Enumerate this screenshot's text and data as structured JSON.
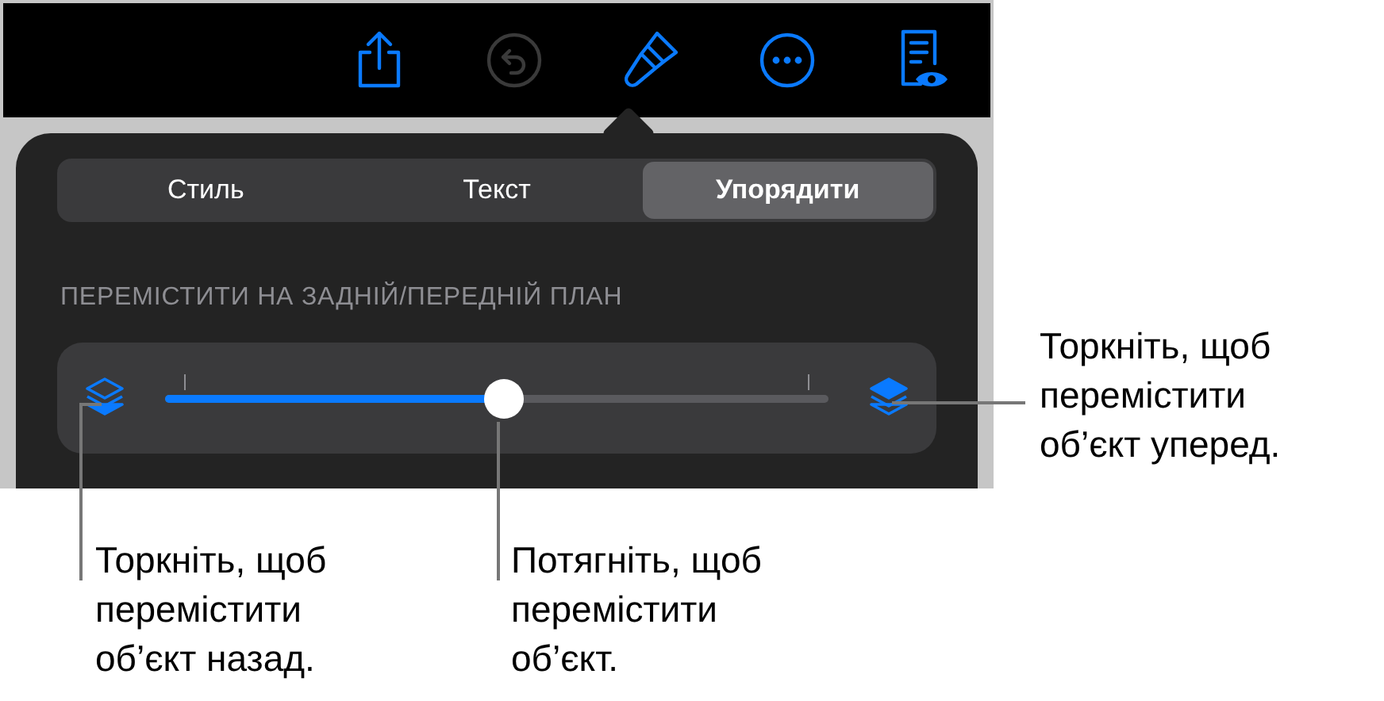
{
  "toolbar": {
    "buttons": [
      {
        "kind": "share",
        "disabled": false
      },
      {
        "kind": "undo",
        "disabled": true
      },
      {
        "kind": "format",
        "disabled": false
      },
      {
        "kind": "more",
        "disabled": false
      },
      {
        "kind": "reader",
        "disabled": false
      }
    ]
  },
  "segments": [
    {
      "label": "Стиль",
      "selected": false
    },
    {
      "label": "Текст",
      "selected": false
    },
    {
      "label": "Упорядити",
      "selected": true
    }
  ],
  "section_title": "ПЕРЕМІСТИТИ НА ЗАДНІЙ/ПЕРЕДНІЙ ПЛАН",
  "slider": {
    "level": 0.51
  },
  "callouts": [
    {
      "kind": "right",
      "text": "Торкніть, щоб\nперемістити\nоб’єкт уперед."
    },
    {
      "kind": "left",
      "text": "Торкніть, щоб\nперемістити\nоб’єкт назад."
    },
    {
      "kind": "middle",
      "text": "Потягніть, щоб\nперемістити\nоб’єкт."
    }
  ]
}
